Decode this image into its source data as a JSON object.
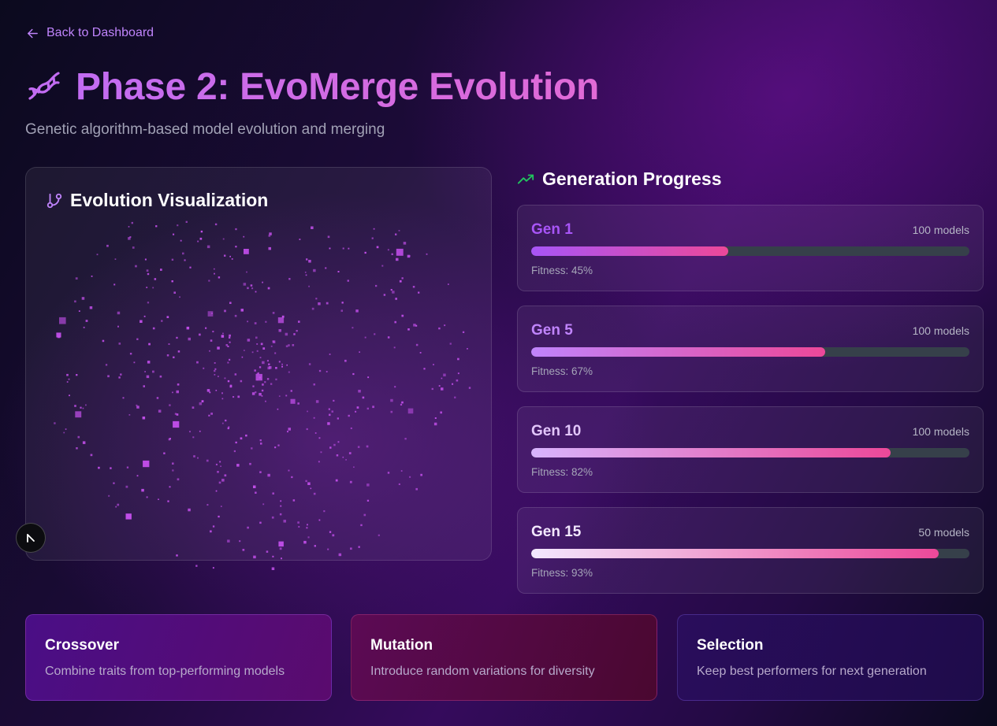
{
  "nav": {
    "back_label": "Back to Dashboard",
    "back_icon": "arrow-left-icon"
  },
  "header": {
    "icon": "dna-icon",
    "title": "Phase 2: EvoMerge Evolution",
    "subtitle": "Genetic algorithm-based model evolution and merging"
  },
  "visualization": {
    "title": "Evolution Visualization",
    "icon": "git-branch-icon",
    "particle_color": "#c04ee8"
  },
  "generation_progress": {
    "title": "Generation Progress",
    "icon": "trending-up-icon",
    "fitness_prefix": "Fitness: ",
    "generations": [
      {
        "label": "Gen 1",
        "models": "100 models",
        "fitness": 45,
        "fitness_text": "45%",
        "label_color": "#a855f7",
        "grad_start": "#a855f7",
        "grad_end": "#ec4899"
      },
      {
        "label": "Gen 5",
        "models": "100 models",
        "fitness": 67,
        "fitness_text": "67%",
        "label_color": "#c084fc",
        "grad_start": "#c084fc",
        "grad_end": "#ec4899"
      },
      {
        "label": "Gen 10",
        "models": "100 models",
        "fitness": 82,
        "fitness_text": "82%",
        "label_color": "#e2c6fb",
        "grad_start": "#d8b4fe",
        "grad_end": "#ec4899"
      },
      {
        "label": "Gen 15",
        "models": "50 models",
        "fitness": 93,
        "fitness_text": "93%",
        "label_color": "#f3e8ff",
        "grad_start": "#f3e8ff",
        "grad_end": "#ec4899"
      }
    ]
  },
  "operations": [
    {
      "title": "Crossover",
      "description": "Combine traits from top-performing models"
    },
    {
      "title": "Mutation",
      "description": "Introduce random variations for diversity"
    },
    {
      "title": "Selection",
      "description": "Keep best performers for next generation"
    }
  ],
  "colors": {
    "accent": "#c084fc",
    "trend": "#22c55e",
    "bar_track": "#36404a"
  }
}
